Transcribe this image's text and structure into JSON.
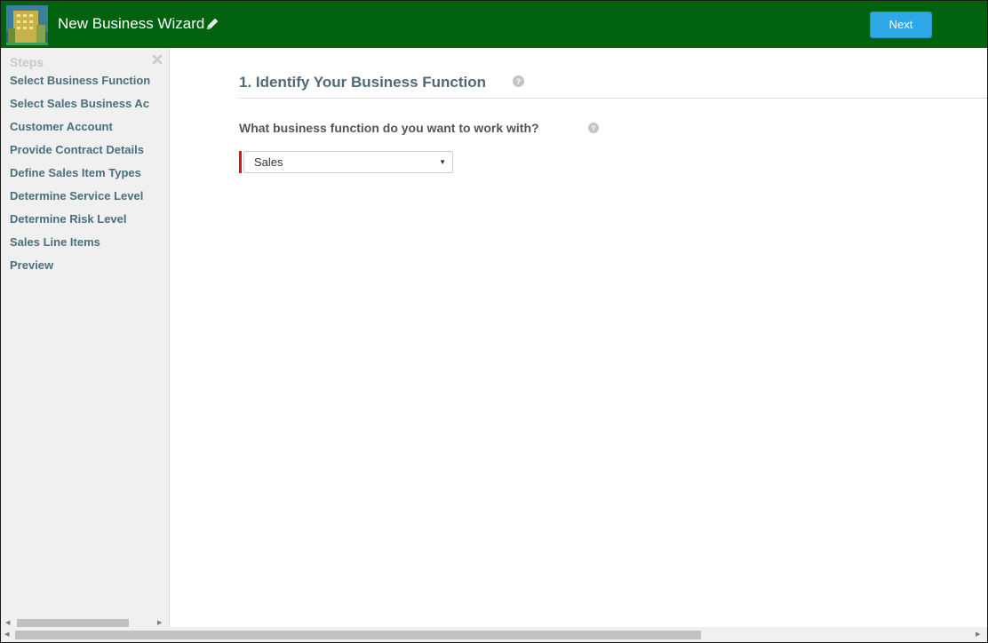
{
  "header": {
    "title": "New Business Wizard",
    "next_label": "Next",
    "background_color": "#00610e",
    "button_color": "#2ea8e6"
  },
  "sidebar": {
    "heading": "Steps",
    "items": [
      {
        "label": "Select Business Function"
      },
      {
        "label": "Select Sales Business Ac"
      },
      {
        "label": "Customer Account"
      },
      {
        "label": "Provide Contract Details"
      },
      {
        "label": "Define Sales Item Types"
      },
      {
        "label": "Determine Service Level"
      },
      {
        "label": "Determine Risk Level"
      },
      {
        "label": "Sales Line Items"
      },
      {
        "label": "Preview"
      }
    ]
  },
  "main": {
    "section_title": "1. Identify Your Business Function",
    "question": "What business function do you want to work with?",
    "business_function_select": {
      "selected": "Sales",
      "required": true
    }
  },
  "icons": {
    "pencil": "pencil-icon",
    "help": "help-icon",
    "close": "close-icon",
    "logo": "building-logo"
  }
}
